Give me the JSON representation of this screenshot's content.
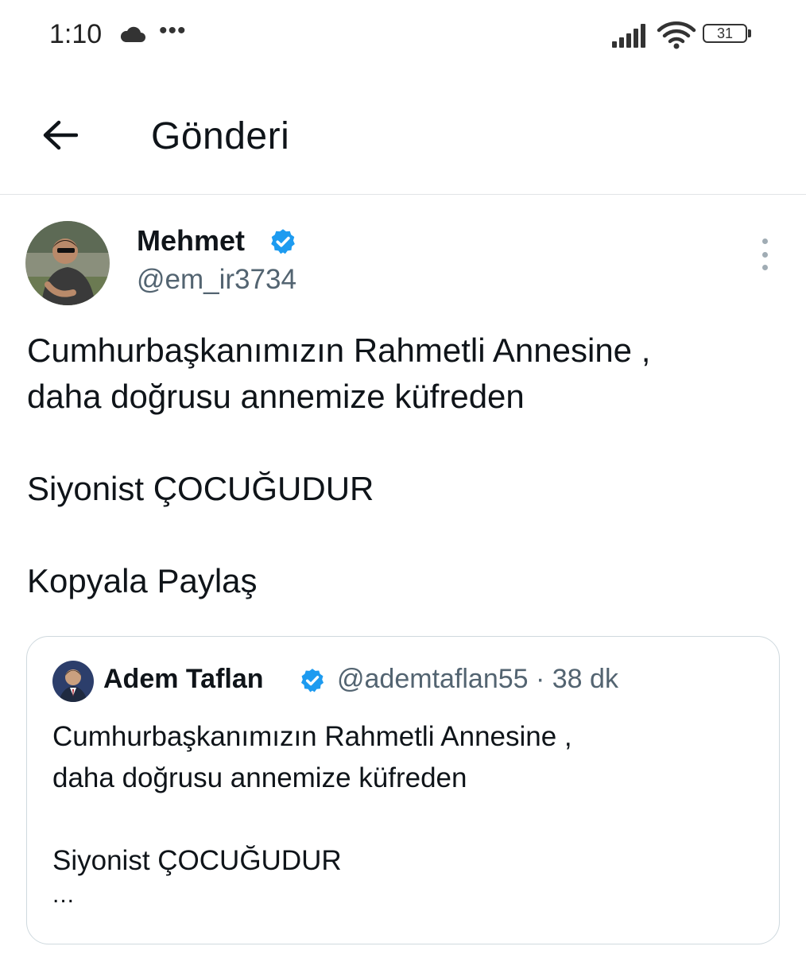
{
  "status_bar": {
    "time": "1:10",
    "overflow_dots": "•••",
    "battery_level": "31"
  },
  "header": {
    "title": "Gönderi"
  },
  "post": {
    "author_name": "Mehmet",
    "handle": "@em_ir3734",
    "text": "Cumhurbaşkanımızın Rahmetli Annesine ,\ndaha doğrusu annemize küfreden\n\nSiyonist ÇOCUĞUDUR\n\nKopyala Paylaş"
  },
  "quote": {
    "author_name": "Adem Taflan",
    "meta": "@ademtaflan55 · 38 dk",
    "text": "Cumhurbaşkanımızın Rahmetli Annesine ,\ndaha doğrusu annemize küfreden\n\nSiyonist ÇOCUĞUDUR",
    "ellipsis": "..."
  },
  "colors": {
    "text_primary": "#0f1419",
    "text_secondary": "#536471",
    "verified_blue": "#1d9bf0",
    "border": "#cfd9de"
  },
  "icons": {
    "back": "arrow-left-icon",
    "verified": "verified-badge-icon",
    "more": "more-vertical-icon",
    "cloud": "cloud-icon",
    "signal": "signal-icon",
    "wifi": "wifi-icon",
    "battery": "battery-icon"
  }
}
